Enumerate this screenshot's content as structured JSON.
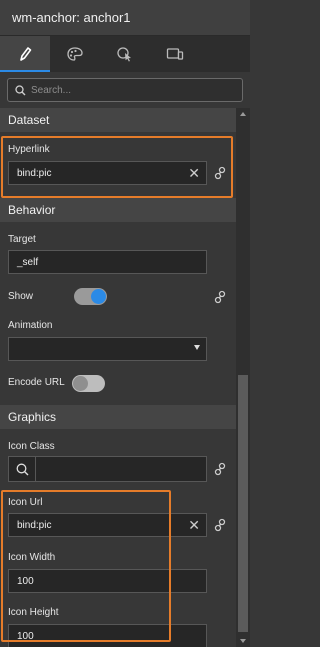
{
  "window": {
    "title": "wm-anchor: anchor1"
  },
  "tabs": [
    {
      "name": "properties",
      "icon": "pencil-icon",
      "active": true
    },
    {
      "name": "styles",
      "icon": "palette-icon",
      "active": false
    },
    {
      "name": "events",
      "icon": "pointer-gear-icon",
      "active": false
    },
    {
      "name": "device",
      "icon": "devices-icon",
      "active": false
    }
  ],
  "search": {
    "placeholder": "Search..."
  },
  "sections": {
    "dataset": "Dataset",
    "behavior": "Behavior",
    "graphics": "Graphics"
  },
  "dataset": {
    "hyperlink_label": "Hyperlink",
    "hyperlink_value": "bind:pic"
  },
  "behavior": {
    "target_label": "Target",
    "target_value": "_self",
    "show_label": "Show",
    "show_on": true,
    "animation_label": "Animation",
    "animation_value": "",
    "encode_url_label": "Encode URL",
    "encode_url_on": false
  },
  "graphics": {
    "icon_class_label": "Icon Class",
    "icon_class_value": "",
    "icon_url_label": "Icon Url",
    "icon_url_value": "bind:pic",
    "icon_width_label": "Icon Width",
    "icon_width_value": "100",
    "icon_height_label": "Icon Height",
    "icon_height_value": "100"
  },
  "colors": {
    "accent": "#2b8ae6",
    "highlight": "#e57c2a",
    "panel": "#373737",
    "section_header": "#454545"
  }
}
